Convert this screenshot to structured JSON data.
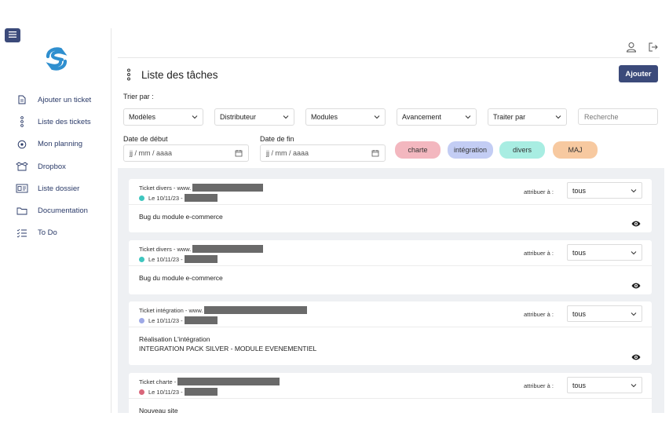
{
  "sidebar": {
    "menu_icon": "hamburger-icon",
    "logo_color": "#2f8fcf",
    "items": [
      {
        "label": "Ajouter un ticket",
        "icon": "file-icon"
      },
      {
        "label": "Liste des tickets",
        "icon": "dots-vertical-icon"
      },
      {
        "label": "Mon planning",
        "icon": "target-icon"
      },
      {
        "label": "Dropbox",
        "icon": "box-icon"
      },
      {
        "label": "Liste dossier",
        "icon": "id-card-icon"
      },
      {
        "label": "Documentation",
        "icon": "folder-icon"
      },
      {
        "label": "To Do",
        "icon": "checklist-icon"
      }
    ]
  },
  "header": {
    "title": "Liste des tâches",
    "add_label": "Ajouter",
    "user_icon": "user-icon",
    "logout_icon": "logout-icon"
  },
  "filters": {
    "sort_label": "Trier par :",
    "selects": [
      "Modèles",
      "Distributeur",
      "Modules",
      "Avancement",
      "Traiter par"
    ],
    "search_placeholder": "Recherche",
    "start_label": "Date de début",
    "end_label": "Date de fin",
    "date_placeholder": "jj / mm / aaaa"
  },
  "categories": [
    {
      "label": "charte",
      "color": "#f3b7bf"
    },
    {
      "label": "intégration",
      "color": "#c3cdf4"
    },
    {
      "label": "divers",
      "color": "#a8ede2"
    },
    {
      "label": "MAJ",
      "color": "#f7c9a0"
    }
  ],
  "assign_label": "attribuer à :",
  "tickets": [
    {
      "type": "Ticket divers - www.",
      "date": "Le 10/11/23 -",
      "dot_color": "#3fc6bf",
      "assign": "tous",
      "body": [
        "Bug du module e-commerce"
      ]
    },
    {
      "type": "Ticket divers - www.",
      "date": "Le 10/11/23 -",
      "dot_color": "#3fc6bf",
      "assign": "tous",
      "body": [
        "Bug du module e-commerce"
      ]
    },
    {
      "type": "Ticket intégration - www.",
      "date": "Le 10/11/23 -",
      "dot_color": "#9ea9e6",
      "assign": "tous",
      "body": [
        "Réalisation L'intégration",
        "INTEGRATION PACK SILVER - MODULE EVENEMENTIEL"
      ]
    },
    {
      "type": "Ticket charte -",
      "date": "Le 10/11/23 -",
      "dot_color": "#d9667a",
      "assign": "tous",
      "body": [
        "Nouveau site"
      ]
    }
  ]
}
